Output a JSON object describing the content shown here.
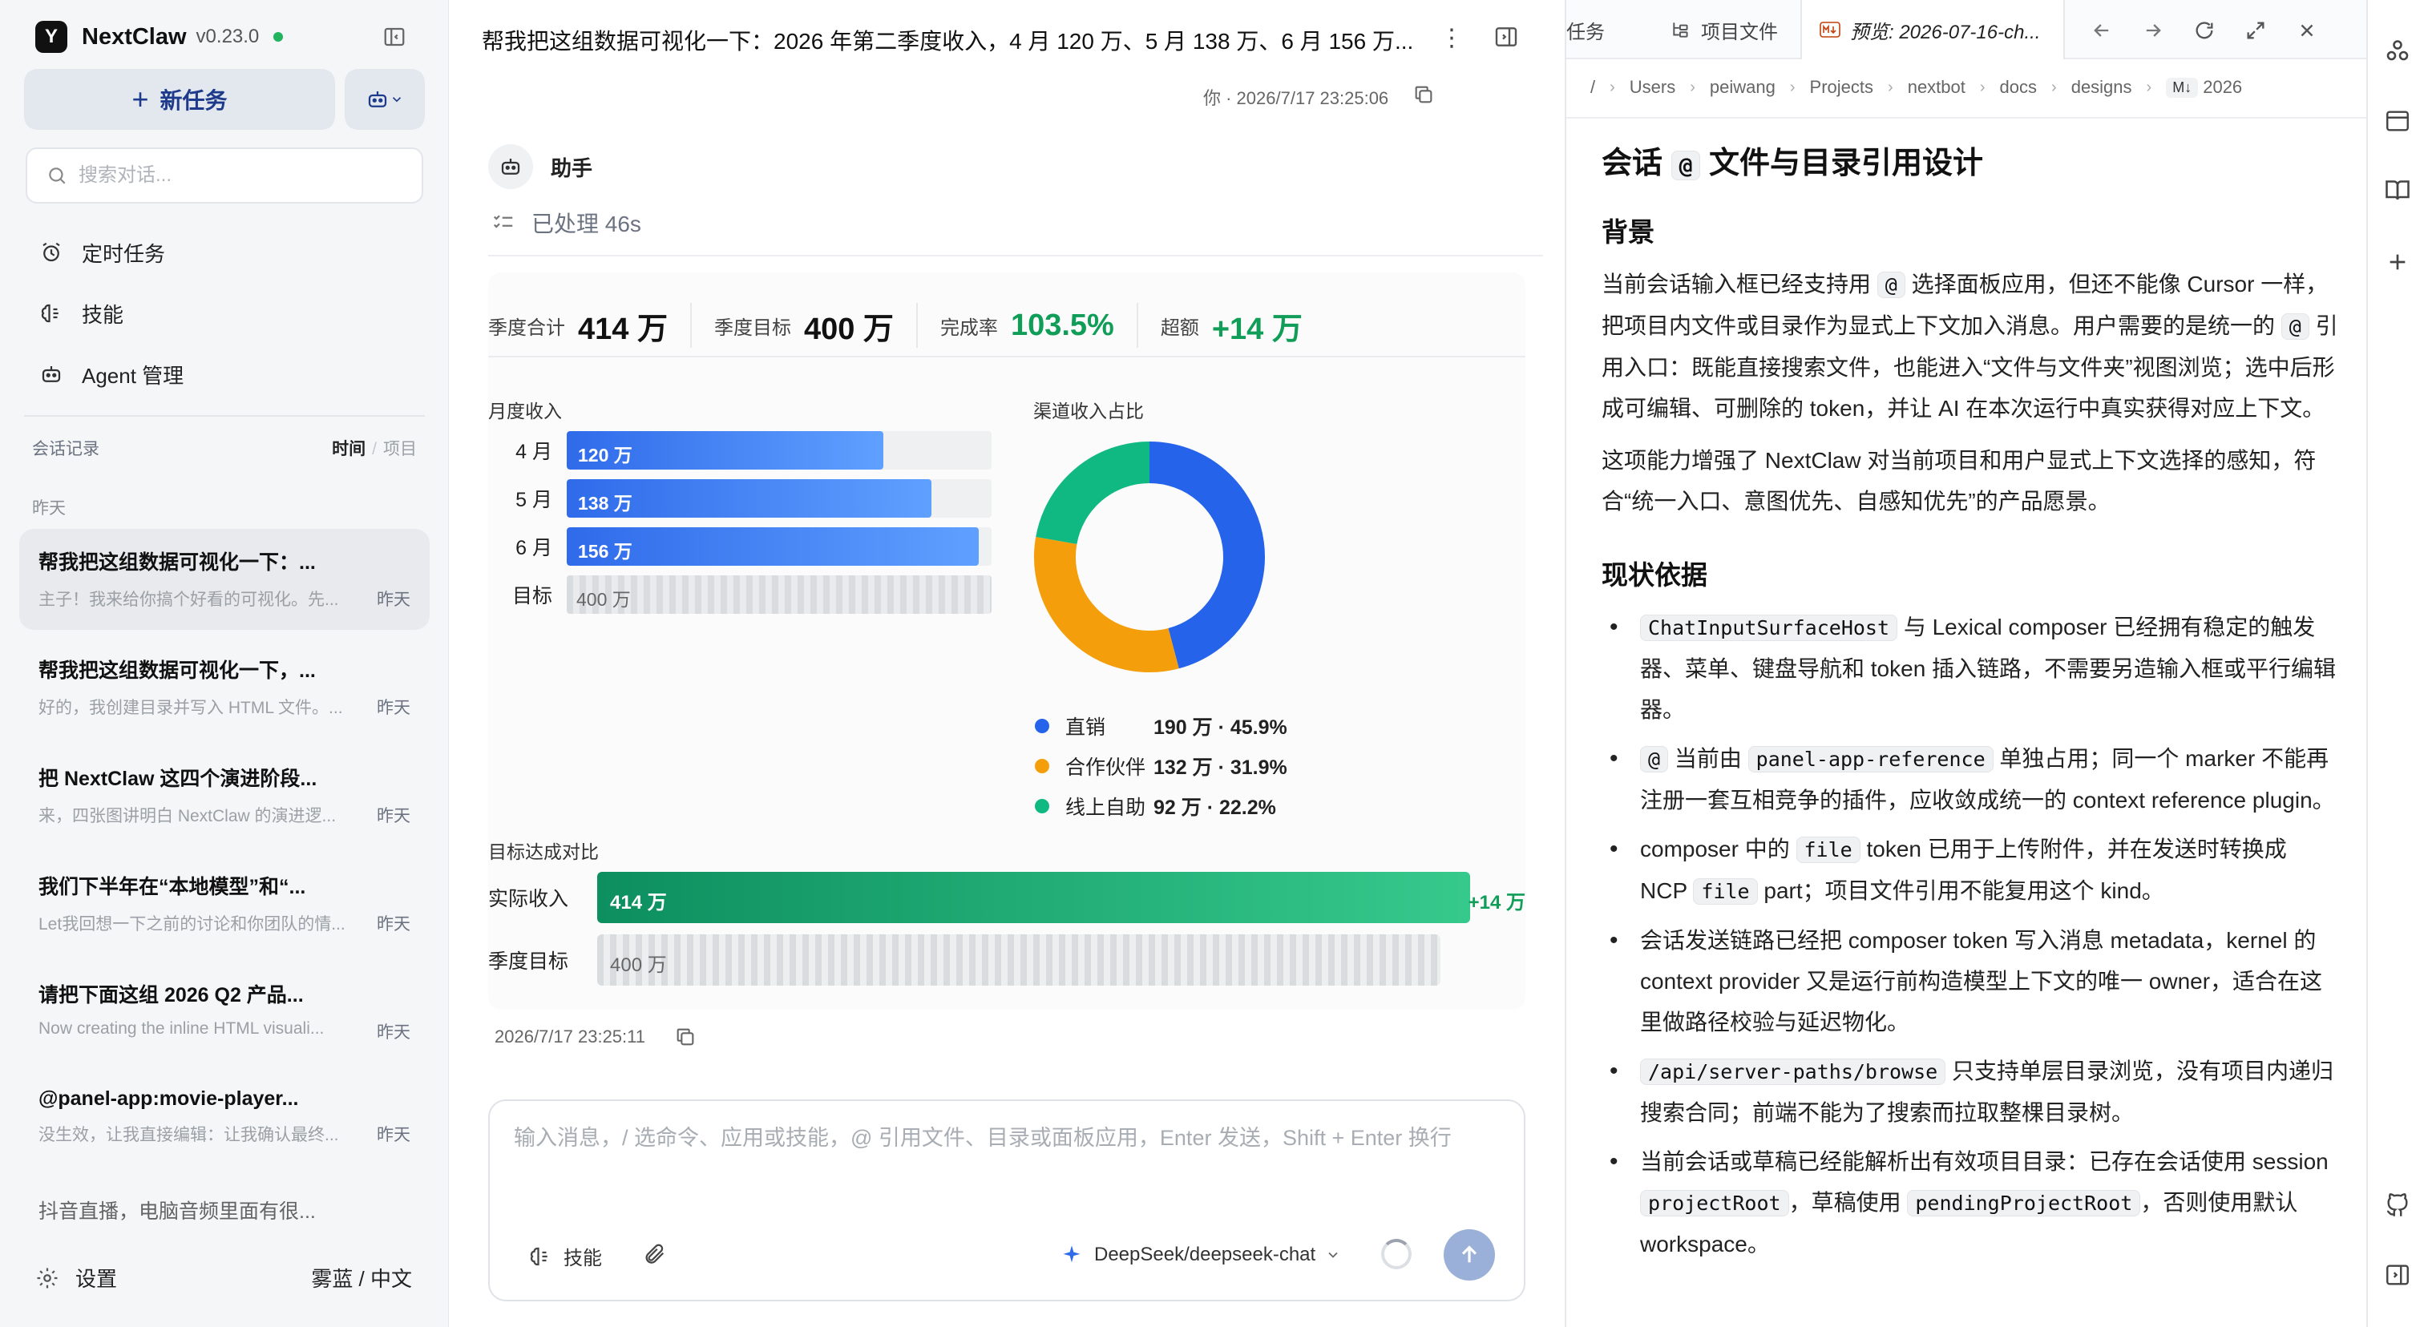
{
  "app": {
    "name": "NextClaw",
    "version": "v0.23.0",
    "status_color": "#22b35e",
    "accent": "#1e3a8a"
  },
  "sidebar": {
    "new_task": "新任务",
    "search_placeholder": "搜索对话...",
    "nav": [
      {
        "label": "定时任务",
        "icon": "alarm-clock-icon"
      },
      {
        "label": "技能",
        "icon": "brain-icon"
      },
      {
        "label": "Agent 管理",
        "icon": "robot-icon"
      }
    ],
    "history_label": "会话记录",
    "sort": {
      "active": "时间",
      "sep": "/",
      "other": "项目"
    },
    "day_label": "昨天",
    "conversations": [
      {
        "title": "帮我把这组数据可视化一下：...",
        "snippet": "主子！我来给你搞个好看的可视化。先...",
        "time": "昨天"
      },
      {
        "title": "帮我把这组数据可视化一下，...",
        "snippet": "好的，我创建目录并写入 HTML 文件。...",
        "time": "昨天"
      },
      {
        "title": "把 NextClaw 这四个演进阶段...",
        "snippet": "来，四张图讲明白 NextClaw 的演进逻...",
        "time": "昨天"
      },
      {
        "title": "我们下半年在“本地模型”和“...",
        "snippet": "Let我回想一下之前的讨论和你团队的情...",
        "time": "昨天"
      },
      {
        "title": "请把下面这组 2026 Q2 产品...",
        "snippet": "Now creating the inline HTML visuali...",
        "time": "昨天"
      },
      {
        "title": "@panel-app:movie-player...",
        "snippet": "没生效，让我直接编辑：让我确认最终...",
        "time": "昨天"
      },
      {
        "title": "抖音直播，电脑音频里面有很...",
        "snippet": "",
        "time": ""
      }
    ],
    "settings": "设置",
    "theme_lang": "雾蓝 / 中文"
  },
  "chat": {
    "title": "帮我把这组数据可视化一下：2026 年第二季度收入，4 月 120 万、5 月 138 万、6 月 156 万...",
    "user_meta": "你 · 2026/7/17 23:25:06",
    "assistant_name": "助手",
    "processed": "已处理 46s",
    "kpis": [
      {
        "label": "季度合计",
        "value": "414 万",
        "accent": false
      },
      {
        "label": "季度目标",
        "value": "400 万",
        "accent": false
      },
      {
        "label": "完成率",
        "value": "103.5%",
        "accent": true
      },
      {
        "label": "超额",
        "value": "+14 万",
        "accent": true
      }
    ],
    "reply_time": "2026/7/17 23:25:11",
    "composer_placeholder": "输入消息，/ 选命令、应用或技能，@ 引用文件、目录或面板应用，Enter 发送，Shift + Enter 换行",
    "skill_label": "技能",
    "model": "DeepSeek/deepseek-chat"
  },
  "chart_data": [
    {
      "type": "bar",
      "title": "月度收入",
      "categories": [
        "4 月",
        "5 月",
        "6 月",
        "目标"
      ],
      "values": [
        120,
        138,
        156,
        400
      ],
      "labels": [
        "120 万",
        "138 万",
        "156 万",
        "400 万"
      ],
      "unit": "万"
    },
    {
      "type": "pie",
      "title": "渠道收入占比",
      "categories": [
        "直销",
        "合作伙伴",
        "线上自助"
      ],
      "values": [
        190,
        132,
        92
      ],
      "percent": [
        45.9,
        31.9,
        22.2
      ],
      "value_labels": [
        "190 万 · 45.9%",
        "132 万 · 31.9%",
        "92 万 · 22.2%"
      ],
      "colors": [
        "#2563eb",
        "#f59e0b",
        "#10b981"
      ]
    },
    {
      "type": "bar",
      "title": "目标达成对比",
      "categories": [
        "实际收入",
        "季度目标"
      ],
      "values": [
        414,
        400
      ],
      "labels": [
        "414 万",
        "400 万"
      ],
      "delta": "+14 万"
    }
  ],
  "preview": {
    "tabs": [
      "任务",
      "项目文件",
      "预览: 2026-07-16-ch..."
    ],
    "breadcrumb": [
      "/",
      "Users",
      "peiwang",
      "Projects",
      "nextbot",
      "docs",
      "designs",
      "2026"
    ],
    "md_badge": "M↓",
    "doc": {
      "h1_pre": "会话",
      "h1_code": "@",
      "h1_post": "文件与目录引用设计",
      "s1_title": "背景",
      "s1_p1_a": "当前会话输入框已经支持用",
      "s1_p1_code1": "@",
      "s1_p1_b": "选择面板应用，但还不能像 Cursor 一样，把项目内文件或目录作为显式上下文加入消息。用户需要的是统一的",
      "s1_p1_code2": "@",
      "s1_p1_c": "引用入口：既能直接搜索文件，也能进入“文件与文件夹”视图浏览；选中后形成可编辑、可删除的 token，并让 AI 在本次运行中真实获得对应上下文。",
      "s1_p2": "这项能力增强了 NextClaw 对当前项目和用户显式上下文选择的感知，符合“统一入口、意图优先、自感知优先”的产品愿景。",
      "s2_title": "现状依据",
      "b1_code": "ChatInputSurfaceHost",
      "b1_text": "与 Lexical composer 已经拥有稳定的触发器、菜单、键盘导航和 token 插入链路，不需要另造输入框或平行编辑器。",
      "b2_code1": "@",
      "b2_a": "当前由",
      "b2_code2": "panel-app-reference",
      "b2_b": "单独占用；同一个 marker 不能再注册一套互相竞争的插件，应收敛成统一的 context reference plugin。",
      "b3_a": "composer 中的",
      "b3_code1": "file",
      "b3_b": "token 已用于上传附件，并在发送时转换成 NCP",
      "b3_code2": "file",
      "b3_c": "part；项目文件引用不能复用这个 kind。",
      "b4_text": "会话发送链路已经把 composer token 写入消息 metadata，kernel 的 context provider 又是运行前构造模型上下文的唯一 owner，适合在这里做路径校验与延迟物化。",
      "b5_code": "/api/server-paths/browse",
      "b5_text": "只支持单层目录浏览，没有项目内递归搜索合同；前端不能为了搜索而拉取整棵目录树。",
      "b6_a": "当前会话或草稿已经能解析出有效项目目录：已存在会话使用 session",
      "b6_code1": "projectRoot",
      "b6_b": "，草稿使用",
      "b6_code2": "pendingProjectRoot",
      "b6_c": "，否则使用默认 workspace。"
    }
  }
}
